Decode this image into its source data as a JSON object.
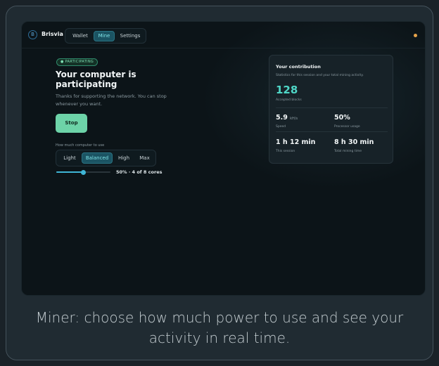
{
  "app": {
    "brand": "Brisvia",
    "logo_glyph": "B",
    "nav": [
      {
        "label": "Wallet",
        "active": false
      },
      {
        "label": "Mine",
        "active": true
      },
      {
        "label": "Settings",
        "active": false
      }
    ],
    "status_color": "#e6a34a"
  },
  "miner": {
    "badge": "● PARTICIPATING",
    "title": "Your computer is participating",
    "description": "Thanks for supporting the network. You can stop whenever you want.",
    "stop_label": "Stop",
    "usage_label": "How much computer to use",
    "levels": [
      {
        "label": "Light",
        "active": false
      },
      {
        "label": "Balanced",
        "active": true
      },
      {
        "label": "High",
        "active": false
      },
      {
        "label": "Max",
        "active": false
      }
    ],
    "slider_percent": 50,
    "slider_text": "50% · 4 of 8 cores"
  },
  "contribution": {
    "title": "Your contribution",
    "subtitle": "Statistics for this session and your total mining activity.",
    "accepted_blocks": "128",
    "accepted_caption": "Accepted blocks",
    "speed_value": "5.9",
    "speed_unit": "kH/s",
    "speed_caption": "Speed",
    "processor_value": "50%",
    "processor_caption": "Processor usage",
    "session_value": "1 h 12 min",
    "session_caption": "This session",
    "total_value": "8 h 30 min",
    "total_caption": "Total mining time"
  },
  "caption": "Miner: choose how much power to use and see your activity in real time.",
  "colors": {
    "accent": "#4fd7c7",
    "stop_button": "#6dd3a8",
    "active_tab": "#1b5463",
    "slider": "#3fb6d6"
  }
}
